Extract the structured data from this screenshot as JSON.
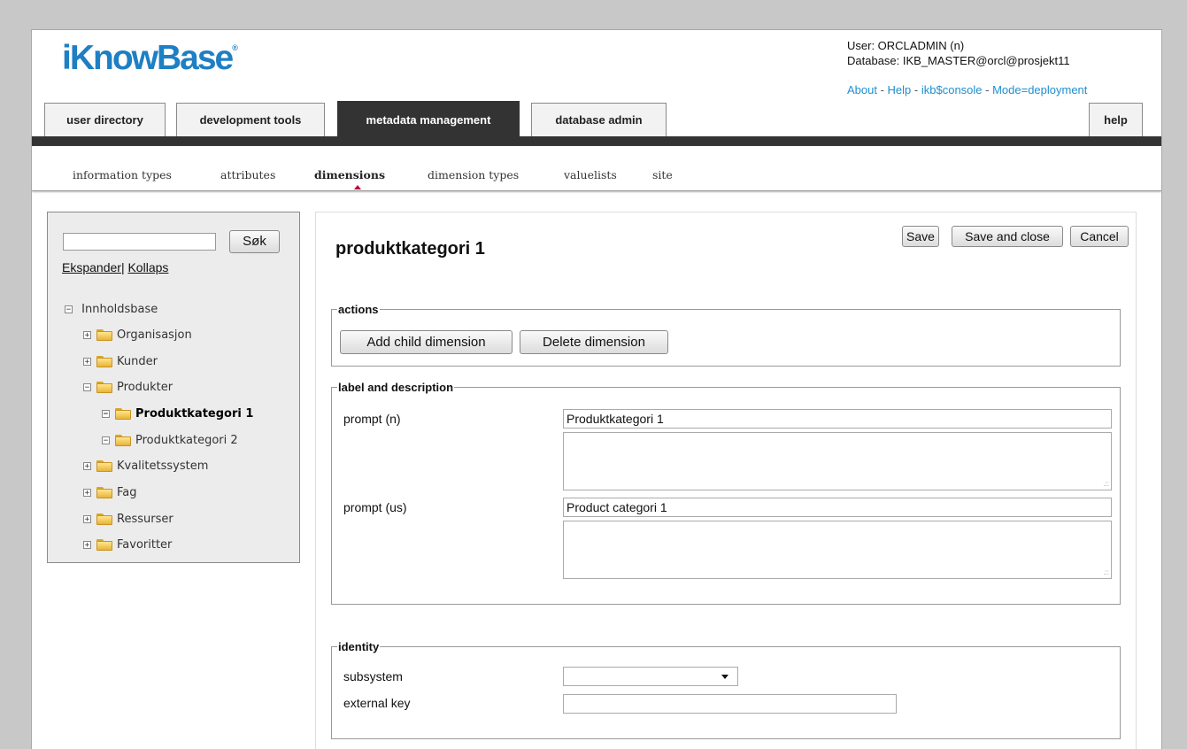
{
  "header": {
    "logo_text": "iKnowBase",
    "logo_mark": "®",
    "user_line": "User: ORCLADMIN (n)",
    "database_line": "Database: IKB_MASTER@orcl@prosjekt11",
    "links": [
      {
        "label": "About"
      },
      {
        "label": "Help"
      },
      {
        "label": "ikb$console"
      },
      {
        "label": "Mode=deployment"
      }
    ],
    "link_separator": " - "
  },
  "tabs": [
    {
      "label": "user directory",
      "active": false
    },
    {
      "label": "development tools",
      "active": false
    },
    {
      "label": "metadata management",
      "active": true
    },
    {
      "label": "database admin",
      "active": false
    },
    {
      "label": "help",
      "active": false
    }
  ],
  "subnav": [
    {
      "label": "information types",
      "active": false
    },
    {
      "label": "attributes",
      "active": false
    },
    {
      "label": "dimensions",
      "active": true
    },
    {
      "label": "dimension types",
      "active": false
    },
    {
      "label": "valuelists",
      "active": false
    },
    {
      "label": "site",
      "active": false
    }
  ],
  "sidebar": {
    "search_button": "Søk",
    "search_value": "",
    "expand_label": "Ekspander",
    "separator": "|",
    "collapse_label": "Kollaps",
    "tree": [
      {
        "label": "Innholdsbase",
        "toggle": "−",
        "folder": false,
        "bold": false
      },
      {
        "label": "Organisasjon",
        "toggle": "+",
        "folder": true,
        "bold": false
      },
      {
        "label": "Kunder",
        "toggle": "+",
        "folder": true,
        "bold": false
      },
      {
        "label": "Produkter",
        "toggle": "−",
        "folder": true,
        "bold": false
      },
      {
        "label": "Produktkategori 1",
        "toggle": "−",
        "folder": true,
        "bold": true
      },
      {
        "label": "Produktkategori 2",
        "toggle": "−",
        "folder": true,
        "bold": false
      },
      {
        "label": "Kvalitetssystem",
        "toggle": "+",
        "folder": true,
        "bold": false
      },
      {
        "label": "Fag",
        "toggle": "+",
        "folder": true,
        "bold": false
      },
      {
        "label": "Ressurser",
        "toggle": "+",
        "folder": true,
        "bold": false
      },
      {
        "label": "Favoritter",
        "toggle": "+",
        "folder": true,
        "bold": false
      }
    ]
  },
  "main": {
    "title": "produktkategori 1",
    "buttons": {
      "save": "Save",
      "save_close": "Save and close",
      "cancel": "Cancel"
    },
    "actions": {
      "legend": "actions",
      "add_child": "Add child dimension",
      "delete": "Delete dimension"
    },
    "label_description": {
      "legend": "label and description",
      "prompt_n_label": "prompt (n)",
      "prompt_n_value": "Produktkategori 1",
      "prompt_n_description": "",
      "prompt_us_label": "prompt (us)",
      "prompt_us_value": "Product categori 1",
      "prompt_us_description": ""
    },
    "identity": {
      "legend": "identity",
      "subsystem_label": "subsystem",
      "subsystem_value": "",
      "external_key_label": "external key",
      "external_key_value": ""
    }
  }
}
